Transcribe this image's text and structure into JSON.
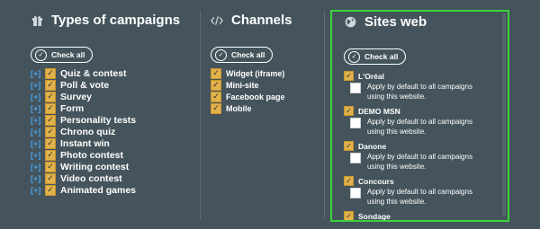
{
  "campaigns": {
    "title": "Types of campaigns",
    "icon": "gift-icon",
    "check_all": "Check all",
    "items": [
      {
        "label": "Quiz & contest",
        "checked": true
      },
      {
        "label": "Poll & vote",
        "checked": true
      },
      {
        "label": "Survey",
        "checked": true
      },
      {
        "label": "Form",
        "checked": true
      },
      {
        "label": "Personality tests",
        "checked": true
      },
      {
        "label": "Chrono quiz",
        "checked": true
      },
      {
        "label": "Instant win",
        "checked": true
      },
      {
        "label": "Photo contest",
        "checked": true
      },
      {
        "label": "Writing contest",
        "checked": true
      },
      {
        "label": "Video contest",
        "checked": true
      },
      {
        "label": "Animated games",
        "checked": true
      }
    ],
    "expand_symbol": "[+]"
  },
  "channels": {
    "title": "Channels",
    "icon": "code-icon",
    "check_all": "Check all",
    "items": [
      {
        "label": "Widget (iframe)",
        "checked": true
      },
      {
        "label": "Mini-site",
        "checked": true
      },
      {
        "label": "Facebook page",
        "checked": true
      },
      {
        "label": "Mobile",
        "checked": true
      }
    ]
  },
  "sites": {
    "title": "Sites web",
    "icon": "globe-icon",
    "check_all": "Check all",
    "option_line1": "Apply by default to all campaigns",
    "option_line2": "using this website.",
    "items": [
      {
        "label": "L'Oréal",
        "checked": true,
        "default_checked": false
      },
      {
        "label": "DEMO MSN",
        "checked": true,
        "default_checked": false
      },
      {
        "label": "Danone",
        "checked": true,
        "default_checked": false
      },
      {
        "label": "Concours",
        "checked": true,
        "default_checked": false
      },
      {
        "label": "Sondage",
        "checked": true,
        "default_checked": false
      }
    ]
  },
  "colors": {
    "background": "#45545c",
    "checkbox_checked": "#e1b24a",
    "expand_link": "#4aa3e8",
    "highlight_frame": "#3bd33b"
  }
}
